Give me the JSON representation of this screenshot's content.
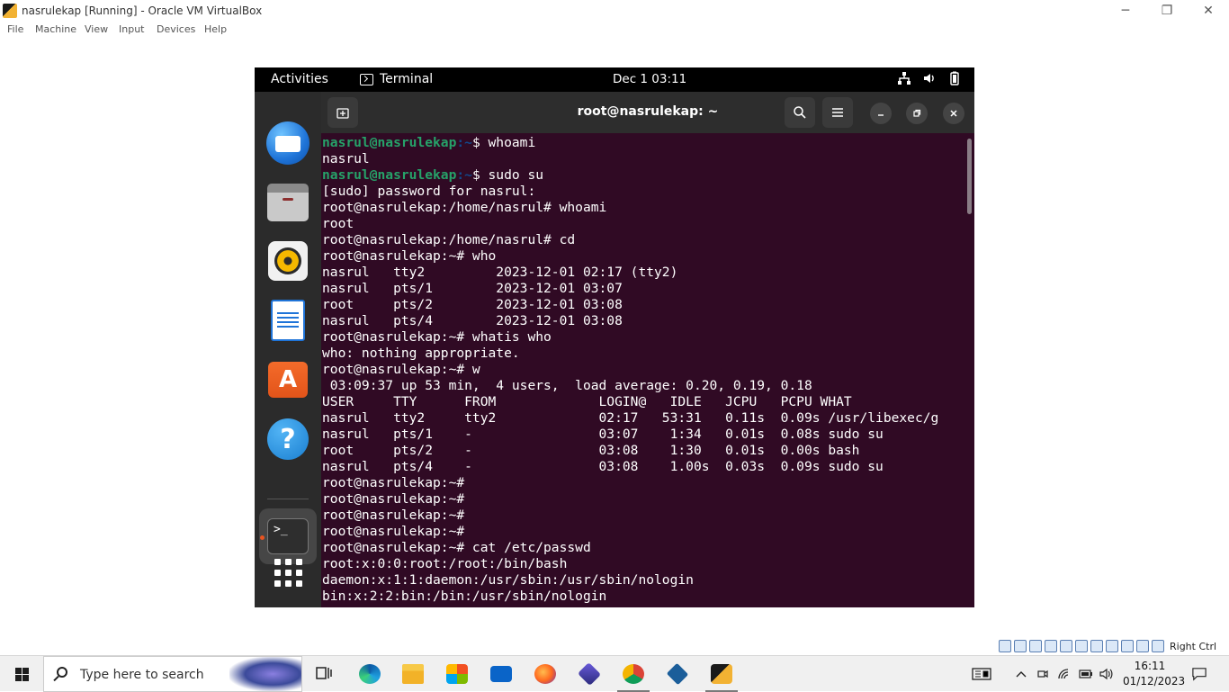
{
  "host_window": {
    "title": "nasrulekap [Running] - Oracle VM VirtualBox",
    "menu": [
      "File",
      "Machine",
      "View",
      "Input",
      "Devices",
      "Help"
    ],
    "controls": {
      "minimize": "─",
      "restore": "❐",
      "close": "✕"
    }
  },
  "guest": {
    "topbar": {
      "activities": "Activities",
      "app_name": "Terminal",
      "clock": "Dec 1  03:11"
    },
    "dock": {
      "items": [
        "thunderbird-icon",
        "files-icon",
        "rhythmbox-icon",
        "libreoffice-writer-icon",
        "ubuntu-software-icon",
        "help-icon",
        "terminal-icon",
        "show-apps-icon"
      ],
      "terminal_label": ">_"
    },
    "terminal": {
      "title": "root@nasrulekap: ~",
      "lines": [
        {
          "user": "nasrul@nasrulekap",
          "path": ":~",
          "rest": "$ whoami"
        },
        {
          "text": "nasrul"
        },
        {
          "user": "nasrul@nasrulekap",
          "path": ":~",
          "rest": "$ sudo su"
        },
        {
          "text": "[sudo] password for nasrul:"
        },
        {
          "text": "root@nasrulekap:/home/nasrul# whoami"
        },
        {
          "text": "root"
        },
        {
          "text": "root@nasrulekap:/home/nasrul# cd"
        },
        {
          "text": "root@nasrulekap:~# who"
        },
        {
          "text": "nasrul   tty2         2023-12-01 02:17 (tty2)"
        },
        {
          "text": "nasrul   pts/1        2023-12-01 03:07"
        },
        {
          "text": "root     pts/2        2023-12-01 03:08"
        },
        {
          "text": "nasrul   pts/4        2023-12-01 03:08"
        },
        {
          "text": "root@nasrulekap:~# whatis who"
        },
        {
          "text": "who: nothing appropriate."
        },
        {
          "text": "root@nasrulekap:~# w"
        },
        {
          "text": " 03:09:37 up 53 min,  4 users,  load average: 0.20, 0.19, 0.18"
        },
        {
          "text": "USER     TTY      FROM             LOGIN@   IDLE   JCPU   PCPU WHAT"
        },
        {
          "text": "nasrul   tty2     tty2             02:17   53:31   0.11s  0.09s /usr/libexec/g"
        },
        {
          "text": "nasrul   pts/1    -                03:07    1:34   0.01s  0.08s sudo su"
        },
        {
          "text": "root     pts/2    -                03:08    1:30   0.01s  0.00s bash"
        },
        {
          "text": "nasrul   pts/4    -                03:08    1.00s  0.03s  0.09s sudo su"
        },
        {
          "text": "root@nasrulekap:~#"
        },
        {
          "text": "root@nasrulekap:~#"
        },
        {
          "text": "root@nasrulekap:~#"
        },
        {
          "text": "root@nasrulekap:~#"
        },
        {
          "text": "root@nasrulekap:~# cat /etc/passwd"
        },
        {
          "text": "root:x:0:0:root:/root:/bin/bash"
        },
        {
          "text": "daemon:x:1:1:daemon:/usr/sbin:/usr/sbin/nologin"
        },
        {
          "text": "bin:x:2:2:bin:/bin:/usr/sbin/nologin"
        }
      ]
    }
  },
  "vb_status": {
    "host_key": "Right Ctrl"
  },
  "taskbar": {
    "search_placeholder": "Type here to search",
    "apps": [
      "task-view-icon",
      "edge-icon",
      "file-explorer-icon",
      "store-icon",
      "mail-icon",
      "firefox-icon",
      "copilot-icon",
      "chrome-icon",
      "virtualbox-icon",
      "virtualbox-vm-icon"
    ],
    "time": "16:11",
    "date": "01/12/2023"
  },
  "colors": {
    "terminal_bg": "#300a24",
    "prompt_user": "#26a269",
    "prompt_path": "#12488b",
    "ubuntu_orange": "#e95420"
  }
}
